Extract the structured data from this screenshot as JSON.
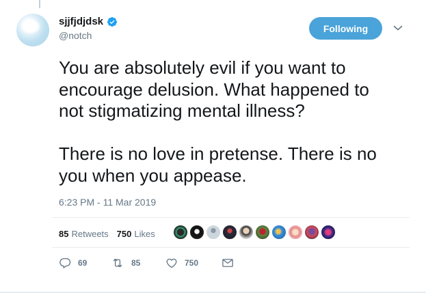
{
  "author": {
    "display_name": "sjjfjdjdsk",
    "handle": "@notch",
    "verified_icon": "verified-badge-icon"
  },
  "follow_button_label": "Following",
  "tweet": {
    "text": "You are absolutely evil if you want to\nencourage delusion. What happened to\nnot stigmatizing mental illness?\n\nThere is no love in pretense. There is no\nyou when you appease.",
    "timestamp": "6:23 PM - 11 Mar 2019"
  },
  "stats": {
    "retweets_count": "85",
    "retweets_label": "Retweets",
    "likes_count": "750",
    "likes_label": "Likes"
  },
  "actions": {
    "reply_count": "69",
    "retweet_count": "85",
    "like_count": "750"
  },
  "colors": {
    "accent": "#4aa3d9",
    "muted_text": "#657786",
    "divider": "#e6ecf0"
  }
}
